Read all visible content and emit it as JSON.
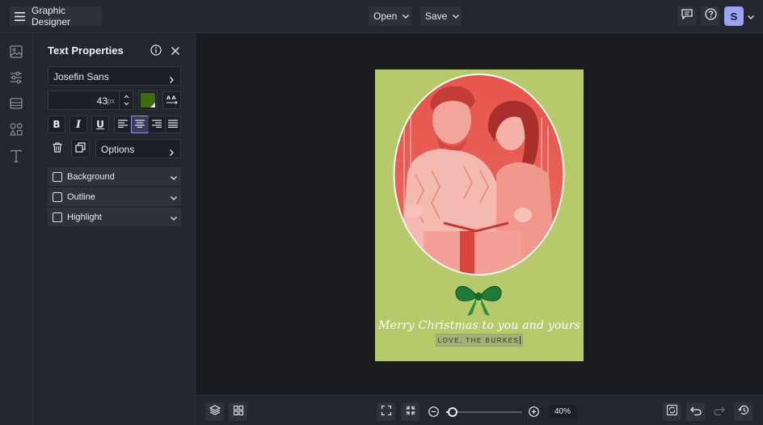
{
  "app": {
    "title": "Graphic Designer",
    "open_label": "Open",
    "save_label": "Save",
    "user_initial": "S"
  },
  "panel": {
    "title": "Text Properties",
    "font_name": "Josefin Sans",
    "font_size": "43",
    "font_unit": "px",
    "text_color": "#3a6e0e",
    "options_label": "Options",
    "accordions": [
      "Background",
      "Outline",
      "Highlight"
    ]
  },
  "card": {
    "background": "#b6c96b",
    "script_text": "Merry Christmas to you and yours",
    "selected_text": "LOVE, THE BURKES"
  },
  "zoom": {
    "level": "40%",
    "slider_position": 0.08
  },
  "colors": {
    "accent": "#8f95f2",
    "avatar": "#9aa3f5"
  }
}
